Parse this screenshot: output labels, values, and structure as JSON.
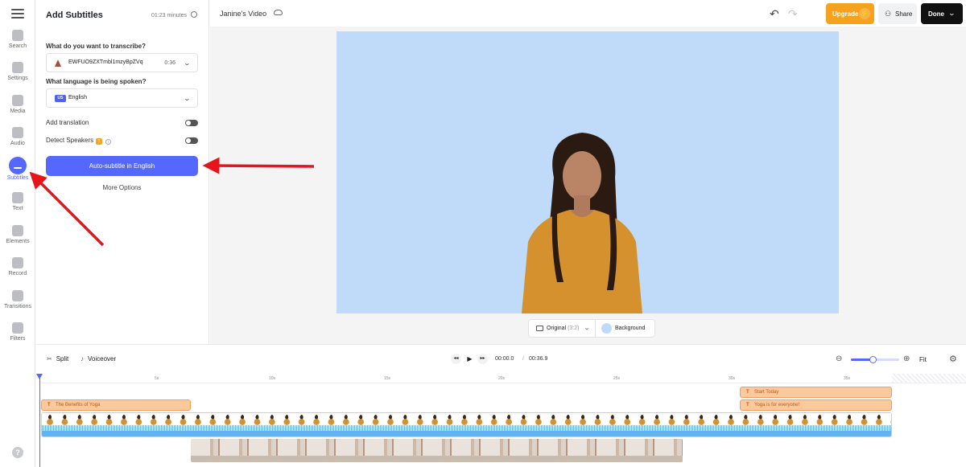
{
  "sidebar": {
    "items": [
      {
        "label": "Search",
        "icon": "search-icon"
      },
      {
        "label": "Settings",
        "icon": "gear-icon"
      },
      {
        "label": "Media",
        "icon": "plus-icon"
      },
      {
        "label": "Audio",
        "icon": "music-note-icon"
      },
      {
        "label": "Subtitles",
        "icon": "subtitles-icon",
        "active": true
      },
      {
        "label": "Text",
        "icon": "text-icon"
      },
      {
        "label": "Elements",
        "icon": "elements-icon"
      },
      {
        "label": "Record",
        "icon": "record-icon"
      },
      {
        "label": "Transitions",
        "icon": "transitions-icon"
      },
      {
        "label": "Filters",
        "icon": "filters-icon"
      }
    ],
    "help": "?"
  },
  "panel": {
    "title": "Add Subtitles",
    "minutes": "01:23 minutes",
    "transcribe_question": "What do you want to transcribe?",
    "file_name": "EWFUO9ZXTmbl1mzyBpZVq",
    "file_duration": "0:36",
    "language_question": "What language is being spoken?",
    "language_flag": "US",
    "language": "English",
    "add_translation": "Add translation",
    "detect_speakers": "Detect Speakers",
    "detect_badge": "!",
    "info": "i",
    "cta": "Auto-subtitle in English",
    "more_options": "More Options"
  },
  "topbar": {
    "project_name": "Janine's Video",
    "undo": "↶",
    "redo": "↷",
    "upgrade": "Upgrade",
    "upgrade_icon": "⚡",
    "share": "Share",
    "share_icon": "👤",
    "done": "Done",
    "done_chevron": "⌄"
  },
  "canvas": {
    "background_color": "#c0dafa",
    "aspect_label": "Original",
    "aspect_ratio": "(3:2)",
    "aspect_chevron": "⌄",
    "background_label": "Background"
  },
  "timeline": {
    "split": "Split",
    "split_icon": "✂",
    "voiceover": "Voiceover",
    "voiceover_icon": "🎙",
    "prev": "◀◀",
    "play": "▶",
    "next": "▶▶",
    "current_time": "00:00.0",
    "separator": "/",
    "total_time": "00:36.9",
    "zoom_out": "⊖",
    "zoom_in": "⊕",
    "zoom_level": 0.45,
    "fit": "Fit",
    "settings": "⚙",
    "ruler_labels": [
      "5s",
      "10s",
      "15s",
      "20s",
      "25s",
      "30s",
      "35s"
    ],
    "text_clip_icon": "T",
    "text_clips": [
      "The Benefits of Yoga",
      "Start Today",
      "Yoga is for everyone!"
    ]
  },
  "colors": {
    "accent": "#5468ff",
    "upgrade": "#f7a21c",
    "text_clip": "#fbc99c",
    "waveform": "#63b3ef",
    "annotation_arrow": "#e8141c"
  }
}
